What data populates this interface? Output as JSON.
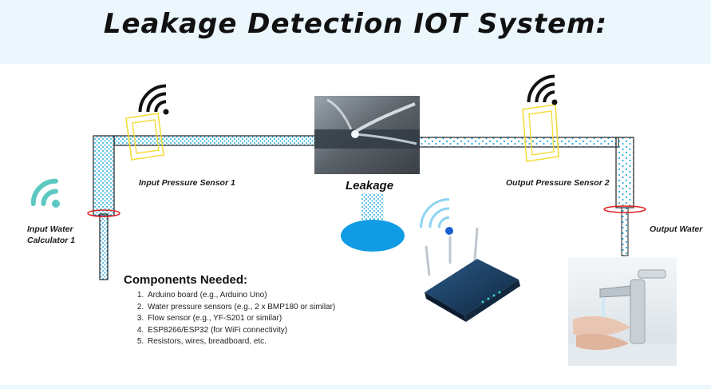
{
  "title": "Leakage Detection IOT System:",
  "labels": {
    "input_sensor": "Input Pressure Sensor 1",
    "output_sensor": "Output Pressure Sensor 2",
    "leakage": "Leakage",
    "input_water": "Input Water",
    "calculator": "Calculator 1",
    "output_water": "Output Water"
  },
  "components": {
    "heading": "Components Needed:",
    "items": [
      "Arduino board (e.g., Arduino Uno)",
      "Water pressure sensors (e.g., 2 x BMP180 or similar)",
      "Flow sensor (e.g., YF-S201 or similar)",
      "ESP8266/ESP32 (for WiFi connectivity)",
      "Resistors, wires, breadboard, etc."
    ]
  },
  "colors": {
    "water": "#2aa8e0",
    "pipe_outline": "#222222",
    "sensor_yellow": "#f2dc3a",
    "meter_red": "#e02020",
    "wifi_teal": "#5ec8c2",
    "router_blue": "#1b3a5c"
  },
  "icons": [
    "wifi-icon",
    "router-icon",
    "faucet-photo",
    "leak-photo"
  ]
}
